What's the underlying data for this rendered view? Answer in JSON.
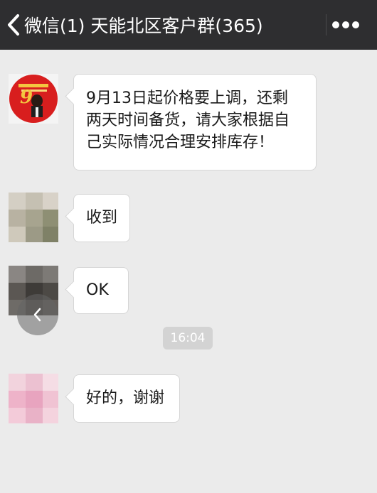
{
  "header": {
    "back_label": "微信(1)",
    "title": "天能北区客户群(365)"
  },
  "messages": [
    {
      "sender": "group-owner",
      "text": "9月13日起价格要上调，还剩\n两天时间备货，请大家根据自\n己实际情况合理安排库存！"
    },
    {
      "sender": "member-1",
      "text": "收到"
    },
    {
      "sender": "member-2",
      "text": "OK"
    },
    {
      "sender": "member-3",
      "text": "好的，谢谢"
    }
  ],
  "timestamp": "16:04",
  "avatar_logo_number": "9",
  "colors": {
    "topbar": "#2e2e30",
    "chat_background": "#ebebeb",
    "bubble": "#ffffff",
    "time_pill": "#d3d3d3"
  }
}
